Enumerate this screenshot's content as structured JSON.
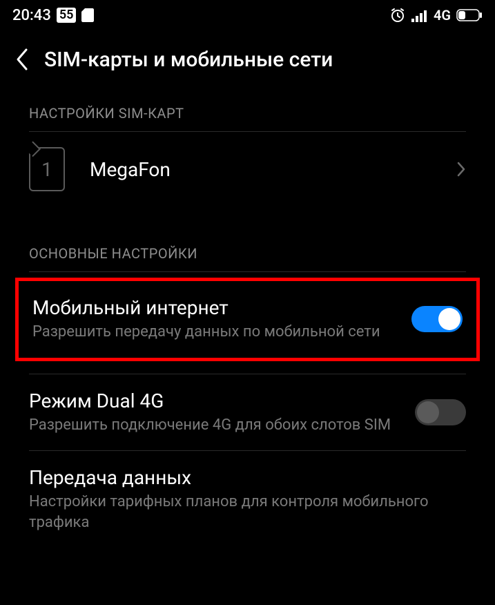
{
  "statusBar": {
    "time": "20:43",
    "badge": "55",
    "netLabel": "4G"
  },
  "header": {
    "title": "SIM-карты и мобильные сети"
  },
  "sections": {
    "simSettings": {
      "label": "НАСТРОЙКИ SIM-КАРТ",
      "slot1": {
        "number": "1",
        "carrier": "MegaFon"
      }
    },
    "mainSettings": {
      "label": "ОСНОВНЫЕ НАСТРОЙКИ",
      "mobileData": {
        "title": "Мобильный интернет",
        "desc": "Разрешить передачу данных по мобильной сети",
        "enabled": true
      },
      "dual4g": {
        "title": "Режим Dual 4G",
        "desc": "Разрешить подключение 4G для обоих слотов SIM",
        "enabled": false
      },
      "dataUsage": {
        "title": "Передача данных",
        "desc": "Настройки тарифных планов для контроля мобильного трафика"
      }
    }
  }
}
